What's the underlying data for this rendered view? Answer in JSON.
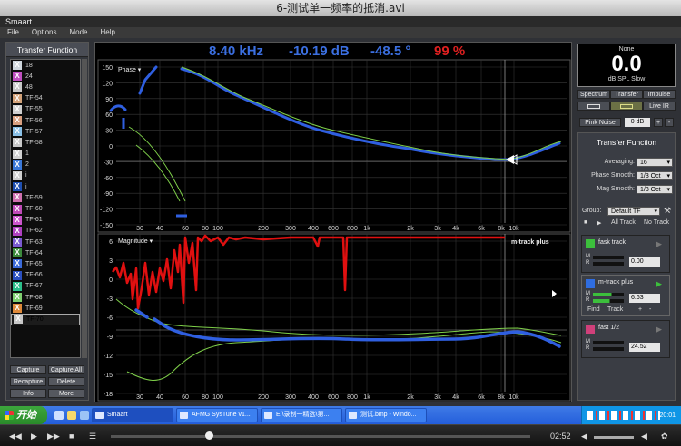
{
  "window": {
    "title": "6-测试单一频率的抵消.avi"
  },
  "app": {
    "name": "Smaart"
  },
  "menu": [
    "File",
    "Options",
    "Mode",
    "Help"
  ],
  "left_panel": {
    "header": "Transfer Function",
    "items": [
      {
        "label": "18",
        "color": "#cfd6dd"
      },
      {
        "label": "24",
        "color": "#c04fc0"
      },
      {
        "label": "48",
        "color": "#c8c8c8"
      },
      {
        "label": "TF-54",
        "color": "#d4a37a"
      },
      {
        "label": "TF-55",
        "color": "#cfcfcf"
      },
      {
        "label": "TF-56",
        "color": "#d9a080"
      },
      {
        "label": "TF-57",
        "color": "#8ac0e6"
      },
      {
        "label": "TF-58",
        "color": "#c8c8c8"
      },
      {
        "label": "1",
        "color": "#d0d0d0"
      },
      {
        "label": "2",
        "color": "#3a78d8"
      },
      {
        "label": "i",
        "color": "#cfcfcf"
      },
      {
        "label": "i",
        "color": "#1f4fb0"
      },
      {
        "label": "TF-59",
        "color": "#d070b0"
      },
      {
        "label": "TF-60",
        "color": "#c04ab8"
      },
      {
        "label": "TF-61",
        "color": "#cc55cc"
      },
      {
        "label": "TF-62",
        "color": "#b040c0"
      },
      {
        "label": "TF-63",
        "color": "#7a5ad0"
      },
      {
        "label": "TF-64",
        "color": "#3c8a3c"
      },
      {
        "label": "TF-65",
        "color": "#3a6ad8"
      },
      {
        "label": "TF-66",
        "color": "#2a4fc0"
      },
      {
        "label": "TF-67",
        "color": "#2bbf8a"
      },
      {
        "label": "TF-68",
        "color": "#7fcf6f"
      },
      {
        "label": "TF-69",
        "color": "#e08a3a"
      },
      {
        "label": "TF-70",
        "color": "#c8c8c8"
      }
    ],
    "buttons": [
      "Capture",
      "Capture All",
      "Recapture",
      "Delete",
      "Info",
      "More"
    ]
  },
  "readout": {
    "freq": "8.40 kHz",
    "mag": "-10.19 dB",
    "phase": "-48.5 °",
    "coh": "99 %"
  },
  "phase_plot": {
    "label": "Phase ▾",
    "yticks": [
      "150",
      "120",
      "90",
      "60",
      "30",
      "0",
      "-30",
      "-60",
      "-90",
      "-120",
      "-150"
    ],
    "xticks": [
      "30",
      "40",
      "60",
      "80",
      "100",
      "200",
      "300",
      "400",
      "600",
      "800",
      "1k",
      "2k",
      "3k",
      "4k",
      "6k",
      "8k",
      "10k"
    ]
  },
  "mag_plot": {
    "label": "Magnitude ▾",
    "trace_label": "m-track plus",
    "yticks": [
      "6",
      "3",
      "0",
      "-3",
      "-6",
      "-9",
      "-12",
      "-15",
      "-18"
    ],
    "xticks": [
      "30",
      "40",
      "60",
      "80",
      "100",
      "200",
      "300",
      "400",
      "600",
      "800",
      "1k",
      "2k",
      "3k",
      "4k",
      "6k",
      "8k",
      "10k"
    ]
  },
  "spl": {
    "top": "None",
    "value": "0.0",
    "unit": "dB SPL Slow"
  },
  "modes": [
    "Spectrum",
    "Transfer",
    "Impulse"
  ],
  "live_ir": "Live IR",
  "pink_noise": {
    "label": "Pink Noise",
    "value": "0 dB",
    "plus": "+",
    "minus": "-"
  },
  "tf_settings": {
    "title": "Transfer Function",
    "averaging_label": "Averaging:",
    "averaging": "16",
    "phase_smooth_label": "Phase Smooth:",
    "phase_smooth": "1/3 Oct",
    "mag_smooth_label": "Mag Smooth:",
    "mag_smooth": "1/3 Oct"
  },
  "group": {
    "label": "Group:",
    "value": "Default TF",
    "all_track": "All Track",
    "no_track": "No Track"
  },
  "tracks": [
    {
      "name": "fask track",
      "value": "0.00",
      "color": "#3cbf3c"
    },
    {
      "name": "m-track plus",
      "value": "6.63",
      "color": "#2f6de0",
      "find": "Find",
      "track": "Track"
    },
    {
      "name": "fast 1/2",
      "value": "24.52",
      "color": "#d0407a"
    }
  ],
  "meter_labels": {
    "m": "M",
    "r": "R"
  },
  "taskbar": {
    "start": "开始",
    "items": [
      "Smaart",
      "AFMG SysTune v1...",
      "E:\\录制一精选\\第...",
      "测试.bmp - Windo..."
    ],
    "clock": "20:01"
  },
  "player": {
    "time": "02:52"
  }
}
